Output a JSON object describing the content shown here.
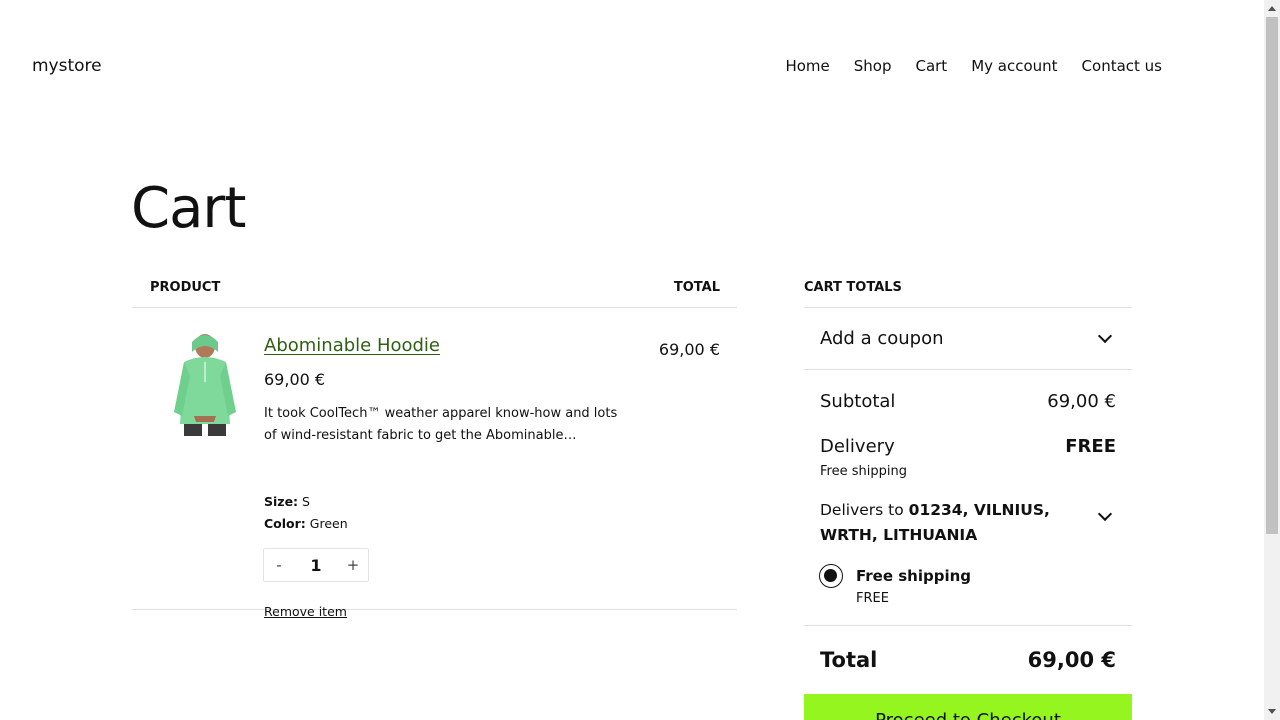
{
  "header": {
    "site_title": "mystore",
    "nav": [
      "Home",
      "Shop",
      "Cart",
      "My account",
      "Contact us"
    ]
  },
  "page": {
    "title": "Cart"
  },
  "cart_table": {
    "col_product": "Product",
    "col_total": "Total",
    "items": [
      {
        "name": "Abominable Hoodie",
        "price": "69,00 €",
        "description": "It took CoolTech™ weather apparel know-how and lots of wind-resistant fabric to get the Abominable…",
        "size_label": "Size:",
        "size_value": "S",
        "color_label": "Color:",
        "color_value": "Green",
        "qty_minus": "-",
        "quantity": "1",
        "qty_plus": "+",
        "remove_label": "Remove item",
        "line_total": "69,00 €",
        "image_color": "#7fd99a"
      }
    ]
  },
  "totals": {
    "heading": "Cart totals",
    "coupon_label": "Add a coupon",
    "subtotal_label": "Subtotal",
    "subtotal_value": "69,00 €",
    "delivery_label": "Delivery",
    "delivery_value": "FREE",
    "delivery_sub": "Free shipping",
    "delivers_to_prefix": "Delivers to",
    "delivers_to_address": "01234, VILNIUS, WRTH, LITHUANIA",
    "shipping_option_name": "Free shipping",
    "shipping_option_price": "FREE",
    "total_label": "Total",
    "total_value": "69,00 €",
    "checkout_label": "Proceed to Checkout",
    "checkout_color": "#94f51f"
  }
}
